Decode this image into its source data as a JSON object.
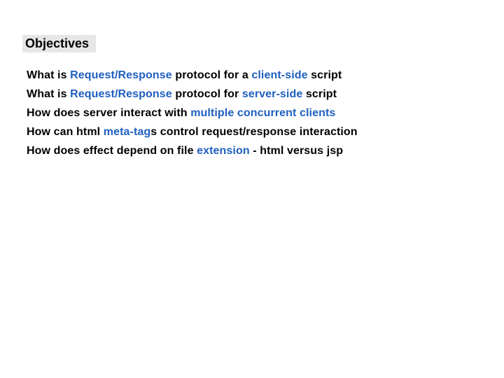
{
  "title": "Objectives",
  "lines": {
    "l1": {
      "a": "What is ",
      "b": "Request/Response",
      "c": " protocol for a ",
      "d": "client-side",
      "e": " script"
    },
    "l2": {
      "a": "What is ",
      "b": "Request/Response",
      "c": " protocol for ",
      "d": "server-side",
      "e": " script"
    },
    "l3": {
      "a": "How does server interact with ",
      "b": "multiple concurrent clients"
    },
    "l4": {
      "a": "How can html ",
      "b": "meta-tag",
      "c": "s control request/response interaction"
    },
    "l5": {
      "a": "How does effect depend on file ",
      "b": "extension",
      "c": " - html versus jsp"
    }
  }
}
